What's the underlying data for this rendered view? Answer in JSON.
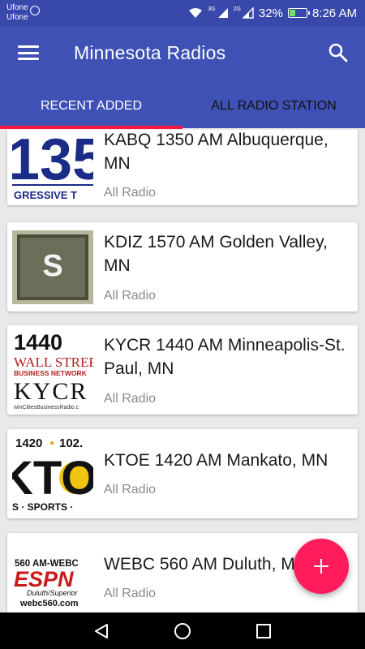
{
  "status_bar": {
    "carrier_1": "Ufone",
    "carrier_2": "Ufone",
    "network_small_1": "3G",
    "network_small_2": "2G",
    "battery": "32%",
    "battery_level": 0.32,
    "time": "8:26 AM"
  },
  "app_bar": {
    "title": "Minnesota Radios",
    "menu_icon": "hamburger-menu-icon",
    "search_icon": "search-icon"
  },
  "tabs": [
    {
      "label": "RECENT ADDED",
      "active": true
    },
    {
      "label": "ALL RADIO STATION",
      "active": false
    }
  ],
  "accent_color": "#ff1744",
  "primary_color": "#3f51b5",
  "stations": [
    {
      "name": "KABQ 1350 AM Albuquerque, MN",
      "category": "All Radio",
      "logo_text_1": "135",
      "logo_text_2": "GRESSIVE T"
    },
    {
      "name": "KDIZ 1570 AM Golden Valley, MN",
      "category": "All Radio",
      "logo_text_1": "S"
    },
    {
      "name": "KYCR 1440 AM Minneapolis-St. Paul, MN",
      "category": "All Radio",
      "logo_text_1": "1440",
      "logo_text_2": "WALL STREET",
      "logo_text_3": "BUSINESS NETWORK",
      "logo_text_4": "KYCR",
      "logo_text_5": "winCitiesBusinessRadio.c"
    },
    {
      "name": "KTOE 1420 AM Mankato, MN",
      "category": "All Radio",
      "logo_text_1": "1420",
      "logo_text_2": "102.",
      "logo_text_3": "KTO",
      "logo_text_4": "S · SPORTS ·"
    },
    {
      "name": "WEBC 560 AM Duluth, MN",
      "category": "All Radio",
      "logo_text_1": "560 AM-WEBC",
      "logo_text_2": "ESPN",
      "logo_text_3": "Duluth/Superior",
      "logo_text_4": "webc560.com"
    }
  ],
  "fab_icon": "plus-icon",
  "nav_bar": {
    "back_icon": "back-triangle-icon",
    "home_icon": "home-circle-icon",
    "recents_icon": "recents-square-icon"
  }
}
